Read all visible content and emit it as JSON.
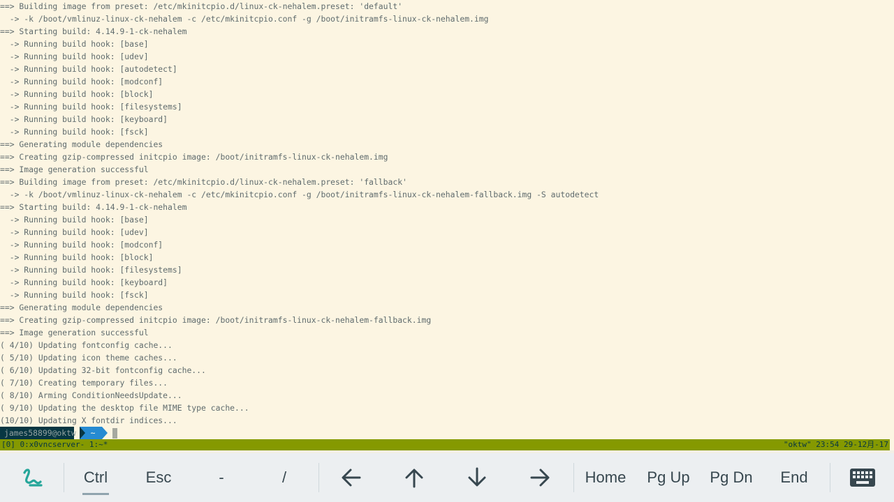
{
  "terminal": {
    "lines": [
      "==> Building image from preset: /etc/mkinitcpio.d/linux-ck-nehalem.preset: 'default'",
      "  -> -k /boot/vmlinuz-linux-ck-nehalem -c /etc/mkinitcpio.conf -g /boot/initramfs-linux-ck-nehalem.img",
      "==> Starting build: 4.14.9-1-ck-nehalem",
      "  -> Running build hook: [base]",
      "  -> Running build hook: [udev]",
      "  -> Running build hook: [autodetect]",
      "  -> Running build hook: [modconf]",
      "  -> Running build hook: [block]",
      "  -> Running build hook: [filesystems]",
      "  -> Running build hook: [keyboard]",
      "  -> Running build hook: [fsck]",
      "==> Generating module dependencies",
      "==> Creating gzip-compressed initcpio image: /boot/initramfs-linux-ck-nehalem.img",
      "==> Image generation successful",
      "==> Building image from preset: /etc/mkinitcpio.d/linux-ck-nehalem.preset: 'fallback'",
      "  -> -k /boot/vmlinuz-linux-ck-nehalem -c /etc/mkinitcpio.conf -g /boot/initramfs-linux-ck-nehalem-fallback.img -S autodetect",
      "==> Starting build: 4.14.9-1-ck-nehalem",
      "  -> Running build hook: [base]",
      "  -> Running build hook: [udev]",
      "  -> Running build hook: [modconf]",
      "  -> Running build hook: [block]",
      "  -> Running build hook: [filesystems]",
      "  -> Running build hook: [keyboard]",
      "  -> Running build hook: [fsck]",
      "==> Generating module dependencies",
      "==> Creating gzip-compressed initcpio image: /boot/initramfs-linux-ck-nehalem-fallback.img",
      "==> Image generation successful",
      "( 4/10) Updating fontconfig cache...",
      "( 5/10) Updating icon theme caches...",
      "( 6/10) Updating 32-bit fontconfig cache...",
      "( 7/10) Creating temporary files...",
      "( 8/10) Arming ConditionNeedsUpdate...",
      "( 9/10) Updating the desktop file MIME type cache...",
      "(10/10) Updating X fontdir indices..."
    ],
    "prompt": {
      "user_host": "james58899@oktw",
      "directory": "~"
    }
  },
  "tmux_status": {
    "left": "[0] 0:x0vncserver- 1:~*",
    "right": "\"oktw\" 23:54 29-12月-17"
  },
  "extra_keys": {
    "logo_icon": "termux-logo-icon",
    "keys": {
      "ctrl": "Ctrl",
      "esc": "Esc",
      "dash": "-",
      "slash": "/",
      "home": "Home",
      "pgup": "Pg Up",
      "pgdn": "Pg Dn",
      "end": "End"
    },
    "arrow_icons": [
      "arrow-left-icon",
      "arrow-up-icon",
      "arrow-down-icon",
      "arrow-right-icon"
    ],
    "keyboard_icon": "keyboard-icon"
  },
  "colors": {
    "terminal_bg": "#fdf6e3",
    "terminal_fg": "#5f6b6d",
    "status_bg": "#859900",
    "prompt_user_bg": "#073642",
    "prompt_dir_bg": "#268bd2",
    "keybar_bg": "#eceff1",
    "logo_color": "#26a69a"
  }
}
